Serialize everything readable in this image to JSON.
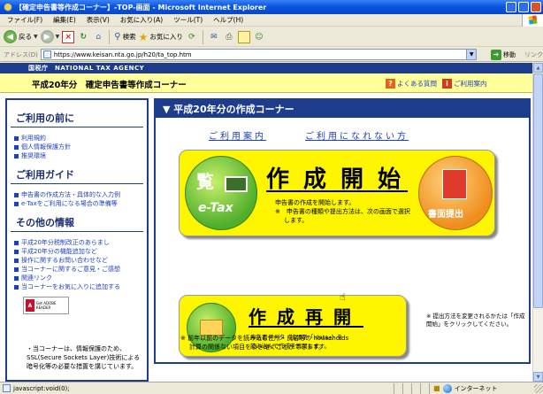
{
  "window": {
    "title": "【確定申告書等作成コーナー】-TOP-画面 - Microsoft Internet Explorer"
  },
  "menu": {
    "items": [
      "ファイル(F)",
      "編集(E)",
      "表示(V)",
      "お気に入り(A)",
      "ツール(T)",
      "ヘルプ(H)"
    ]
  },
  "toolbar": {
    "back_label": "戻る",
    "search_label": "検索",
    "favorites_label": "お気に入り"
  },
  "address": {
    "label": "アドレス(D)",
    "url": "https://www.keisan.nta.go.jp/h20/ta_top.htm",
    "go_label": "移動",
    "links_label": "リンク"
  },
  "page": {
    "agency_bar": "国税庁　NATIONAL TAX AGENCY",
    "title": "平成20年分　確定申告書等作成コーナー",
    "faq_link": "よくある質問",
    "guide_link": "ご利用案内",
    "sidebar": {
      "section1": {
        "heading": "ご利用の前に",
        "items": [
          "利用規約",
          "個人情報保護方針",
          "推奨環境"
        ]
      },
      "section2": {
        "heading": "ご利用ガイド",
        "items": [
          "申告書の作成方法・具体的な入力例",
          "e-Taxをご利用になる場合の準備等"
        ]
      },
      "section3": {
        "heading": "その他の情報",
        "items": [
          "平成20年分税制改正のあらまし",
          "平成20年分の機能追加など",
          "操作に関するお問い合わせなど",
          "当コーナーに関するご意見・ご感想",
          "関連リンク",
          "当コーナーをお気に入りに追加する"
        ]
      },
      "adobe": {
        "badge": "Get ADOBE READER"
      },
      "ssl_note": "・当コーナーは、情報保護のため、SSL(Secure Sockets Layer)技術による暗号化等の必要な措置を講じています。"
    },
    "main": {
      "title": "▼ 平成20年分の作成コーナー",
      "link_guide": "ご利用案内",
      "link_cannot_use": "ご利用になれない方",
      "start": {
        "etax_badge": "e-Tax",
        "etax_kanji": "覧",
        "title": "作成開始",
        "desc1": "申告書の作成を開始します。",
        "desc2": "※　申告書の種類や提出方法は、次の画面で選択",
        "desc3": "します。",
        "paper_badge": "書面提出"
      },
      "resume": {
        "title": "作成再開",
        "desc1": "申告書データ（拡張子「.data」）を",
        "desc2": "読み込んで作成を再開します。"
      },
      "side_note": "※ 提出方法を変更されるかたは「作成開始」をクリックしてください。",
      "bottom_note1": "※ 前年以前のデータを読み込む住所・氏名等の households",
      "bottom_note2": "計算の関係ない項目を引き継ぐことができます。"
    }
  },
  "status": {
    "text": "javascript:void(0);",
    "zone": "インターネット"
  }
}
